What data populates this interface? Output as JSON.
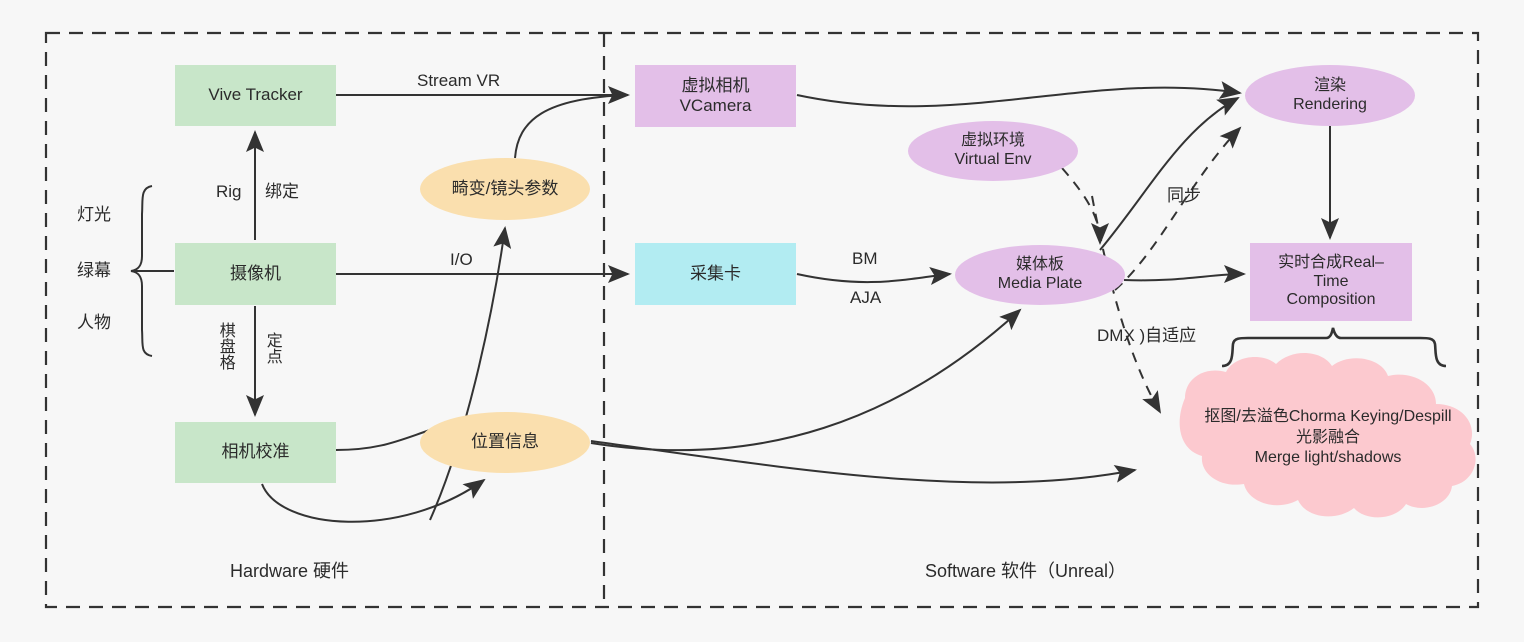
{
  "diagram": {
    "title": "Virtual Production Pipeline",
    "sections": [
      {
        "id": "hardware",
        "label": "Hardware 硬件"
      },
      {
        "id": "software",
        "label": "Software 软件（Unreal）"
      }
    ],
    "colors": {
      "green": "#c8e6c9",
      "purple": "#e3bfe8",
      "orange": "#fadfae",
      "cyan": "#b2ecf2",
      "pink": "#fcc9cf",
      "stroke": "#333333",
      "text": "#2b2b2b",
      "background": "#f7f7f7"
    },
    "nodes": [
      {
        "id": "vive-tracker",
        "lines": [
          "Vive Tracker"
        ],
        "shape": "rect",
        "color": "green"
      },
      {
        "id": "camera",
        "lines": [
          "摄像机"
        ],
        "shape": "rect",
        "color": "green"
      },
      {
        "id": "camera-calib",
        "lines": [
          "相机校准"
        ],
        "shape": "rect",
        "color": "green"
      },
      {
        "id": "lens-params",
        "lines": [
          "畸变/镜头参数"
        ],
        "shape": "ellipse",
        "color": "orange"
      },
      {
        "id": "position-info",
        "lines": [
          "位置信息"
        ],
        "shape": "ellipse",
        "color": "orange"
      },
      {
        "id": "vcamera",
        "lines": [
          "虚拟相机",
          "VCamera"
        ],
        "shape": "rect",
        "color": "purple"
      },
      {
        "id": "capture-card",
        "lines": [
          "采集卡"
        ],
        "shape": "rect",
        "color": "cyan"
      },
      {
        "id": "virtual-env",
        "lines": [
          "虚拟环境",
          "Virtual Env"
        ],
        "shape": "ellipse",
        "color": "purple"
      },
      {
        "id": "media-plate",
        "lines": [
          "媒体板",
          "Media Plate"
        ],
        "shape": "ellipse",
        "color": "purple"
      },
      {
        "id": "rendering",
        "lines": [
          "渲染",
          "Rendering"
        ],
        "shape": "ellipse",
        "color": "purple"
      },
      {
        "id": "composition",
        "lines": [
          "实时合成Real–",
          "Time",
          "Composition"
        ],
        "shape": "rect",
        "color": "purple"
      },
      {
        "id": "keying-cloud",
        "lines": [
          "抠图/去溢色Chorma Keying/Despill",
          "光影融合",
          "Merge light/shadows"
        ],
        "shape": "cloud",
        "color": "pink"
      }
    ],
    "edge_labels": [
      {
        "id": "stream-vr",
        "text": "Stream VR"
      },
      {
        "id": "rig",
        "text": "Rig"
      },
      {
        "id": "bangding",
        "text": "绑定"
      },
      {
        "id": "io",
        "text": "I/O"
      },
      {
        "id": "qipange",
        "text": "棋盘格"
      },
      {
        "id": "dingdian",
        "text": "定点"
      },
      {
        "id": "bm",
        "text": "BM"
      },
      {
        "id": "aja",
        "text": "AJA"
      },
      {
        "id": "tongbu",
        "text": "同步"
      },
      {
        "id": "dmx",
        "text": "DMX )自适应"
      }
    ],
    "brace_inputs": [
      {
        "id": "lighting",
        "text": "灯光"
      },
      {
        "id": "green-screen",
        "text": "绿幕"
      },
      {
        "id": "subject",
        "text": "人物"
      }
    ]
  }
}
